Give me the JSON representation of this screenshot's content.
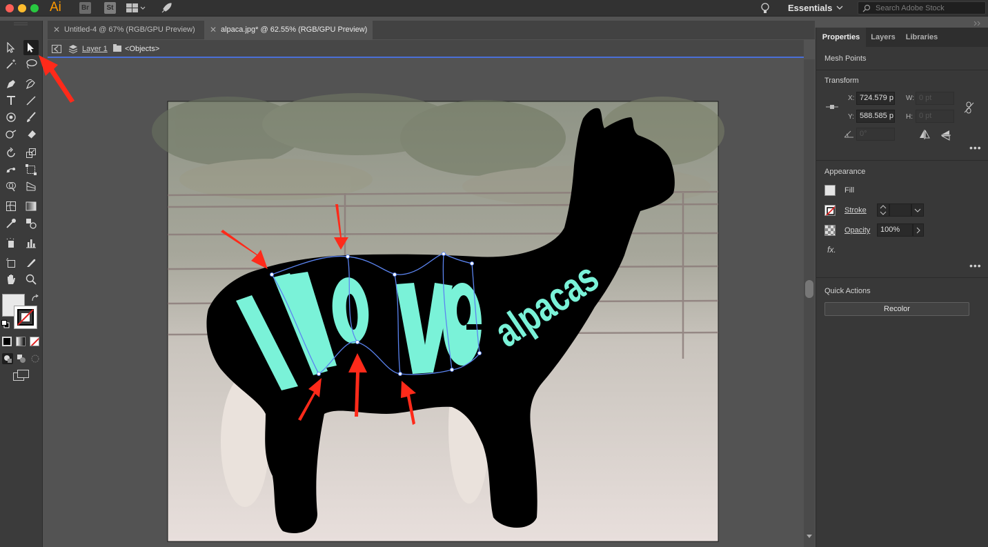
{
  "app": {
    "logo": "Ai",
    "bridge": "Br",
    "stock": "St",
    "workspace": "Essentials",
    "search_placeholder": "Search Adobe Stock"
  },
  "tabs": [
    {
      "label": "Untitled-4 @ 67% (RGB/GPU Preview)",
      "active": false
    },
    {
      "label": "alpaca.jpg* @ 62.55% (RGB/GPU Preview)",
      "active": true
    }
  ],
  "breadcrumb": {
    "layer": "Layer 1",
    "objects": "<Objects>"
  },
  "artwork": {
    "text1": "I love",
    "text2": "alpacas"
  },
  "panel": {
    "tabs": [
      "Properties",
      "Layers",
      "Libraries"
    ],
    "selection": "Mesh Points",
    "transform": {
      "title": "Transform",
      "x_label": "X:",
      "x_value": "724.579 p",
      "y_label": "Y:",
      "y_value": "588.585 p",
      "w_label": "W:",
      "w_value": "0 pt",
      "h_label": "H:",
      "h_value": "0 pt",
      "angle_value": "0°"
    },
    "appearance": {
      "title": "Appearance",
      "fill": "Fill",
      "stroke": "Stroke",
      "opacity": "Opacity",
      "opacity_value": "100%",
      "fx": "fx."
    },
    "quick_actions": {
      "title": "Quick Actions",
      "recolor": "Recolor"
    }
  },
  "colors": {
    "accent": "#4a6fd8",
    "text_art": "#7af2d8",
    "arrow": "#ff2a1a",
    "mesh": "#5b84f0"
  }
}
